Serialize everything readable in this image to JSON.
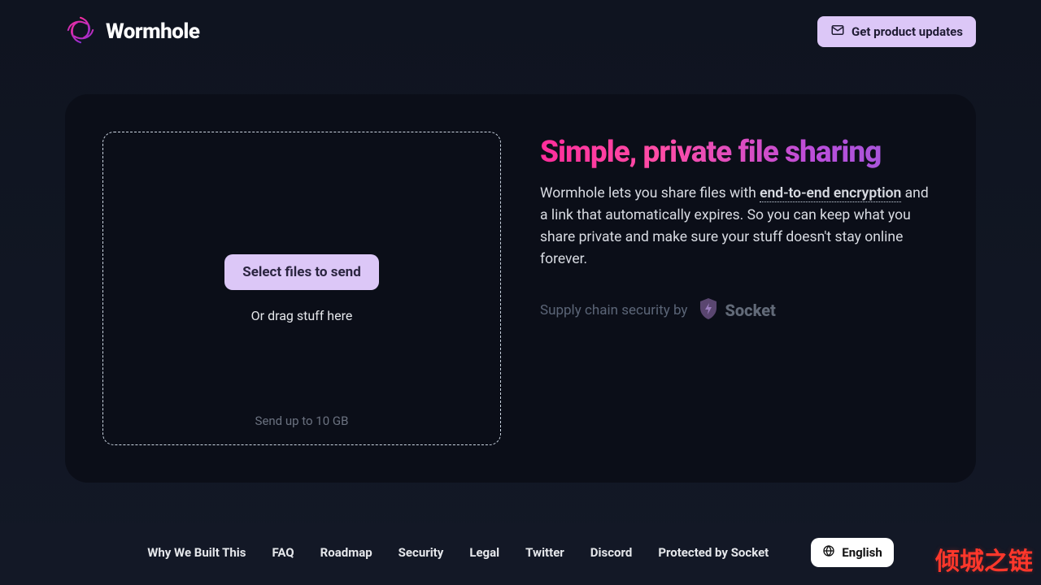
{
  "header": {
    "brand": "Wormhole",
    "updates_label": "Get product updates"
  },
  "dropzone": {
    "select_label": "Select files to send",
    "drag_hint": "Or drag stuff here",
    "size_limit": "Send up to 10 GB"
  },
  "info": {
    "heading": "Simple, private file sharing",
    "desc_pre": "Wormhole lets you share files with ",
    "e2e_text": "end-to-end encryption",
    "desc_post": " and a link that automatically expires. So you can keep what you share private and make sure your stuff doesn't stay online forever.",
    "socket_prefix": "Supply chain security by",
    "socket_name": "Socket"
  },
  "footer": {
    "links": [
      "Why We Built This",
      "FAQ",
      "Roadmap",
      "Security",
      "Legal",
      "Twitter",
      "Discord",
      "Protected by Socket"
    ],
    "language": "English"
  },
  "watermark": "倾城之链"
}
